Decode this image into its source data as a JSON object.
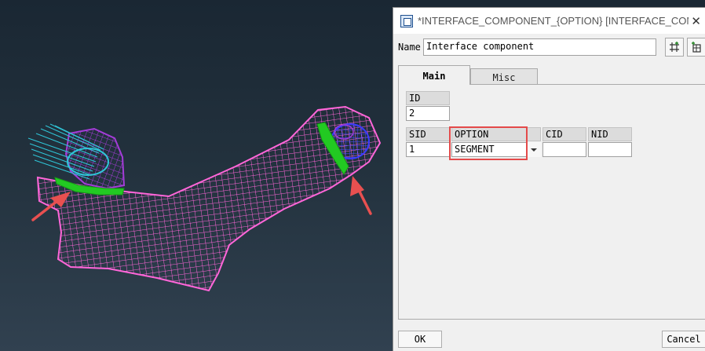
{
  "window": {
    "title": "*INTERFACE_COMPONENT_{OPTION} [INTERFACE_COMP...",
    "close_glyph": "✕"
  },
  "form": {
    "name_label": "Name",
    "name_value": "Interface component"
  },
  "tabs": [
    {
      "label": "Main",
      "active": true
    },
    {
      "label": "Misc",
      "active": false
    }
  ],
  "fields": {
    "id": {
      "label": "ID",
      "value": "2"
    },
    "sid": {
      "label": "SID",
      "value": "1"
    },
    "option": {
      "label": "OPTION",
      "value": "SEGMENT"
    },
    "cid": {
      "label": "CID",
      "value": ""
    },
    "nid": {
      "label": "NID",
      "value": ""
    }
  },
  "buttons": {
    "ok": "OK",
    "cancel": "Cancel"
  },
  "colors": {
    "mesh_main": "#ff66d9",
    "mesh_purple": "#a43cd8",
    "mesh_blue": "#3b3bff",
    "mesh_cyan": "#2fc6d8",
    "mesh_green": "#22c922",
    "highlight": "#e44a4a"
  }
}
